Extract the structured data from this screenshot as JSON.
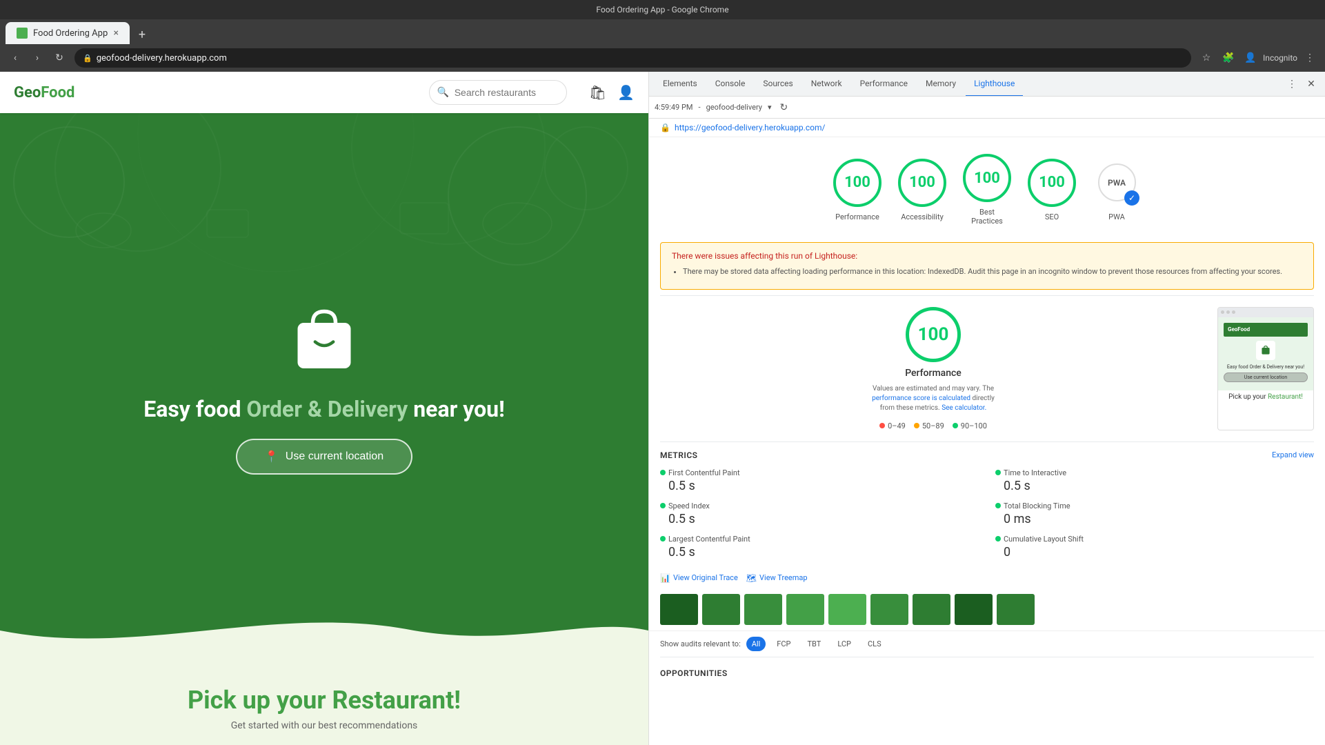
{
  "browser": {
    "title": "Food Ordering App - Google Chrome",
    "tab_label": "Food Ordering App",
    "tab_close": "×",
    "tab_new": "+",
    "nav": {
      "back": "‹",
      "forward": "›",
      "refresh": "↻"
    },
    "address": "geofood-delivery.herokuapp.com",
    "address_lock": "🔒",
    "profile": "Incognito"
  },
  "devtools": {
    "tabs": [
      "Elements",
      "Console",
      "Sources",
      "Network",
      "Performance",
      "Memory",
      "Lighthouse"
    ],
    "active_tab": "Lighthouse",
    "secondary_bar": {
      "time": "4:59:49 PM",
      "url_label": "geofood-delivery",
      "refresh_icon": "↻"
    },
    "url_full": "https://geofood-delivery.herokuapp.com/",
    "scores": [
      {
        "label": "Performance",
        "value": "100",
        "color": "#0cce6b"
      },
      {
        "label": "Accessibility",
        "value": "100",
        "color": "#0cce6b"
      },
      {
        "label": "Best Practices",
        "value": "100",
        "color": "#0cce6b"
      },
      {
        "label": "SEO",
        "value": "100",
        "color": "#0cce6b"
      }
    ],
    "pwa_label": "PWA",
    "warning": {
      "title": "There were issues affecting this run of Lighthouse:",
      "items": [
        "There may be stored data affecting loading performance in this location: IndexedDB. Audit this page in an incognito window to prevent those resources from affecting your scores."
      ]
    },
    "performance": {
      "score": "100",
      "label": "Performance",
      "note_text": "Values are estimated and may vary. The",
      "note_link1": "performance score is calculated",
      "note_link2": "See calculator.",
      "note_mid": "directly from these metrics.",
      "legend": [
        {
          "range": "0–49",
          "color": "#ff4e42"
        },
        {
          "range": "50–89",
          "color": "#ffa400"
        },
        {
          "range": "90–100",
          "color": "#0cce6b"
        }
      ]
    },
    "metrics": {
      "title": "METRICS",
      "expand": "Expand view",
      "items": [
        {
          "name": "First Contentful Paint",
          "value": "0.5 s"
        },
        {
          "name": "Time to Interactive",
          "value": "0.5 s"
        },
        {
          "name": "Speed Index",
          "value": "0.5 s"
        },
        {
          "name": "Total Blocking Time",
          "value": "0 ms"
        },
        {
          "name": "Largest Contentful Paint",
          "value": "0.5 s"
        },
        {
          "name": "Cumulative Layout Shift",
          "value": "0"
        }
      ]
    },
    "view_buttons": [
      {
        "label": "View Original Trace",
        "icon": "📊"
      },
      {
        "label": "View Treemap",
        "icon": "🗺"
      }
    ],
    "audit_tabs": [
      "All",
      "FCP",
      "TBT",
      "LCP",
      "CLS"
    ],
    "active_audit_tab": "All",
    "opportunities_label": "OPPORTUNITIES",
    "show_audits_label": "Show audits relevant to:"
  },
  "app": {
    "logo": "GeoFood",
    "logo_color_geo": "#2e7d32",
    "logo_color_food": "#43a047",
    "search_placeholder": "Search restaurants",
    "hero": {
      "title_part1": "Easy food ",
      "title_part2": "Order & Delivery",
      "title_part3": " near you!",
      "location_btn": "Use current location"
    },
    "pickup": {
      "title_part1": "Pick up your ",
      "title_part2": "Restaurant!",
      "subtitle": "Get started with our best recommendations"
    }
  }
}
